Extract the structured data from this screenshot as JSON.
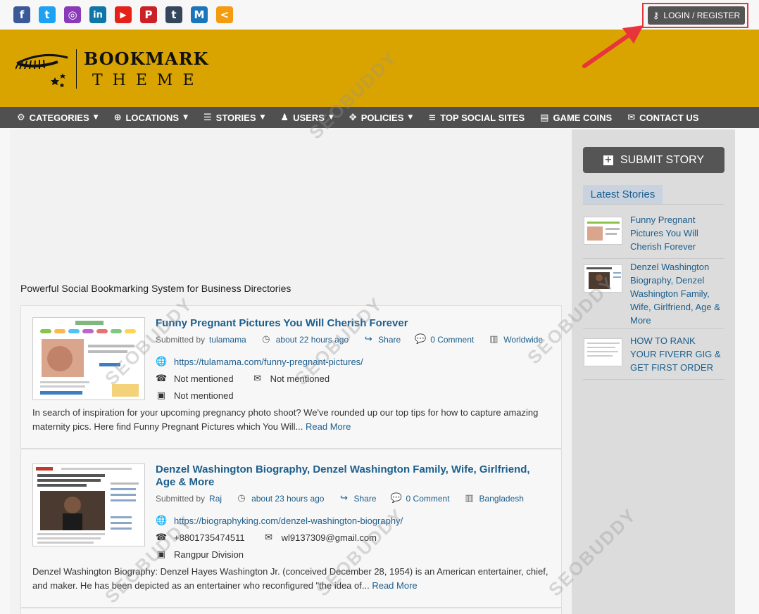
{
  "social": {
    "icons": [
      {
        "name": "facebook-icon",
        "glyph": "f",
        "color": "#3b5998"
      },
      {
        "name": "twitter-icon",
        "glyph": "t",
        "color": "#1da1f2"
      },
      {
        "name": "instagram-icon",
        "glyph": "◎",
        "color": "#8a3ab9"
      },
      {
        "name": "linkedin-icon",
        "glyph": "in",
        "color": "#0e76a8"
      },
      {
        "name": "youtube-icon",
        "glyph": "▶",
        "color": "#e62117"
      },
      {
        "name": "pinterest-icon",
        "glyph": "P",
        "color": "#cb2027"
      },
      {
        "name": "tumblr-icon",
        "glyph": "t",
        "color": "#35465c"
      },
      {
        "name": "medium-icon",
        "glyph": "M",
        "color": "#1a75ba"
      },
      {
        "name": "share-icon",
        "glyph": "<",
        "color": "#f39c12"
      }
    ]
  },
  "header": {
    "login_label": "LOGIN / REGISTER",
    "logo_line1": "BOOKMARK",
    "logo_line2": "THEME"
  },
  "nav": {
    "items": [
      {
        "label": "CATEGORIES",
        "icon": "⚙",
        "dropdown": true
      },
      {
        "label": "LOCATIONS",
        "icon": "⊕",
        "dropdown": true
      },
      {
        "label": "STORIES",
        "icon": "☰",
        "dropdown": true
      },
      {
        "label": "USERS",
        "icon": "♟",
        "dropdown": true
      },
      {
        "label": "POLICIES",
        "icon": "✥",
        "dropdown": true
      },
      {
        "label": "TOP SOCIAL SITES",
        "icon": "≡",
        "dropdown": false
      },
      {
        "label": "GAME COINS",
        "icon": "▤",
        "dropdown": false
      },
      {
        "label": "CONTACT US",
        "icon": "✉",
        "dropdown": false
      }
    ]
  },
  "main": {
    "tagline": "Powerful Social Bookmarking System for Business Directories",
    "stories": [
      {
        "title": "Funny Pregnant Pictures You Will Cherish Forever",
        "submitted_prefix": "Submitted by",
        "author": "tulamama",
        "time": "about 22 hours ago",
        "share": "Share",
        "comments": "0 Comment",
        "location": "Worldwide",
        "url": "https://tulamama.com/funny-pregnant-pictures/",
        "phone": "Not mentioned",
        "email": "Not mentioned",
        "address": "Not mentioned",
        "description": "In search of inspiration for your upcoming pregnancy photo shoot? We've rounded up our top tips for how to capture amazing maternity pics. Here find Funny Pregnant Pictures which You Will...",
        "read_more": "Read More"
      },
      {
        "title": "Denzel Washington Biography, Denzel Washington Family, Wife, Girlfriend, Age & More",
        "submitted_prefix": "Submitted by",
        "author": "Raj",
        "time": "about 23 hours ago",
        "share": "Share",
        "comments": "0 Comment",
        "location": "Bangladesh",
        "url": "https://biographyking.com/denzel-washington-biography/",
        "phone": "+8801735474511",
        "email": "wl9137309@gmail.com",
        "address": "Rangpur Division",
        "description": "Denzel Washington Biography: Denzel Hayes Washington Jr. (conceived December 28, 1954) is an American entertainer, chief, and maker. He has been depicted as an entertainer who reconfigured \"the idea of...",
        "read_more": "Read More"
      }
    ]
  },
  "sidebar": {
    "submit_label": "SUBMIT STORY",
    "latest_title": "Latest Stories",
    "latest": [
      "Funny Pregnant Pictures You Will Cherish Forever",
      "Denzel Washington Biography, Denzel Washington Family, Wife, Girlfriend, Age & More",
      "HOW TO RANK YOUR FIVERR GIG & GET FIRST ORDER"
    ]
  },
  "watermark": "SEOBUDDY",
  "colors": {
    "header_bg": "#d9a400",
    "nav_bg": "#505050",
    "link": "#1c5e8c",
    "highlight": "#e8353b"
  }
}
